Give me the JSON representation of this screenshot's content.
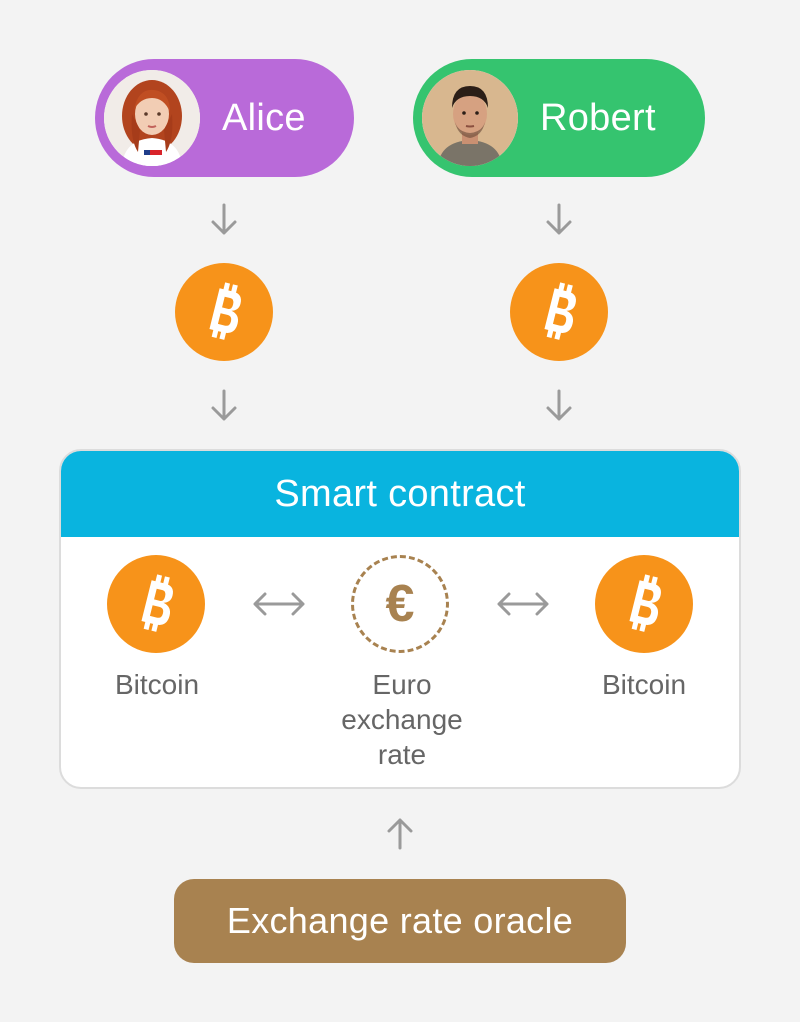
{
  "people": {
    "alice": {
      "name": "Alice",
      "color": "#b96ad9"
    },
    "robert": {
      "name": "Robert",
      "color": "#35c46f"
    }
  },
  "contract": {
    "title": "Smart contract",
    "header_color": "#09b4df",
    "left_label": "Bitcoin",
    "middle_label_lines": [
      "Euro",
      "exchange",
      "rate"
    ],
    "right_label": "Bitcoin",
    "euro_symbol": "€"
  },
  "oracle": {
    "label": "Exchange rate oracle",
    "color": "#a88250"
  },
  "icons": {
    "coin": "bitcoin-icon",
    "arrow_down": "arrow-down-icon",
    "arrow_up": "arrow-up-icon",
    "swap": "double-arrow-icon"
  },
  "colors": {
    "bitcoin": "#f7931a",
    "arrow": "#9a9a9a"
  }
}
